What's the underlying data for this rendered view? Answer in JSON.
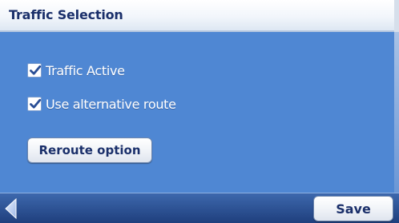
{
  "header": {
    "title": "Traffic Selection"
  },
  "options": [
    {
      "label": "Traffic Active",
      "checked": true
    },
    {
      "label": "Use alternative route",
      "checked": true
    }
  ],
  "reroute_button": {
    "label": "Reroute option"
  },
  "footer": {
    "back_icon": "back-arrow-icon",
    "save_label": "Save"
  },
  "colors": {
    "content_bg": "#4f87d3",
    "title_text": "#1a2f6a",
    "footer_bg": "#1f3f7d"
  }
}
